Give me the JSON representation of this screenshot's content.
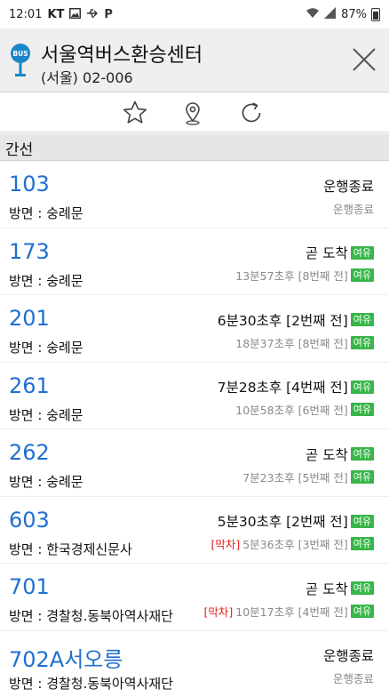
{
  "statusbar": {
    "time": "12:01",
    "carrier": "KT",
    "battery": "87%"
  },
  "header": {
    "title": "서울역버스환승센터",
    "subtitle": "(서울) 02-006",
    "stop_icon_label": "BUS"
  },
  "section": {
    "label": "간선"
  },
  "colors": {
    "route_number": "#1f6fd1",
    "badge_green": "#39b54a",
    "last_bus_red": "#e0201b"
  },
  "routes": [
    {
      "number": "103",
      "direction": "방면 : 숭례문",
      "first": "운행종료",
      "first_badge": "",
      "second_last": "",
      "second": "운행종료",
      "second_badge": ""
    },
    {
      "number": "173",
      "direction": "방면 : 숭례문",
      "first": "곧 도착",
      "first_badge": "여유",
      "second_last": "",
      "second": "13분57초후 [8번째 전]",
      "second_badge": "여유"
    },
    {
      "number": "201",
      "direction": "방면 : 숭례문",
      "first": "6분30초후 [2번째 전]",
      "first_badge": "여유",
      "second_last": "",
      "second": "18분37초후 [8번째 전]",
      "second_badge": "여유"
    },
    {
      "number": "261",
      "direction": "방면 : 숭례문",
      "first": "7분28초후 [4번째 전]",
      "first_badge": "여유",
      "second_last": "",
      "second": "10분58초후 [6번째 전]",
      "second_badge": "여유"
    },
    {
      "number": "262",
      "direction": "방면 : 숭례문",
      "first": "곧 도착",
      "first_badge": "여유",
      "second_last": "",
      "second": "7분23초후 [5번째 전]",
      "second_badge": "여유"
    },
    {
      "number": "603",
      "direction": "방면 : 한국경제신문사",
      "first": "5분30초후 [2번째 전]",
      "first_badge": "여유",
      "second_last": "[막차]",
      "second": "5분36초후 [3번째 전]",
      "second_badge": "여유"
    },
    {
      "number": "701",
      "direction": "방면 : 경찰청.동북아역사재단",
      "first": "곧 도착",
      "first_badge": "여유",
      "second_last": "[막차]",
      "second": "10분17초후 [4번째 전]",
      "second_badge": "여유"
    },
    {
      "number": "702A서오릉",
      "direction": "방면 : 경찰청.동북아역사재단",
      "first": "운행종료",
      "first_badge": "",
      "second_last": "",
      "second": "운행종료",
      "second_badge": ""
    }
  ]
}
